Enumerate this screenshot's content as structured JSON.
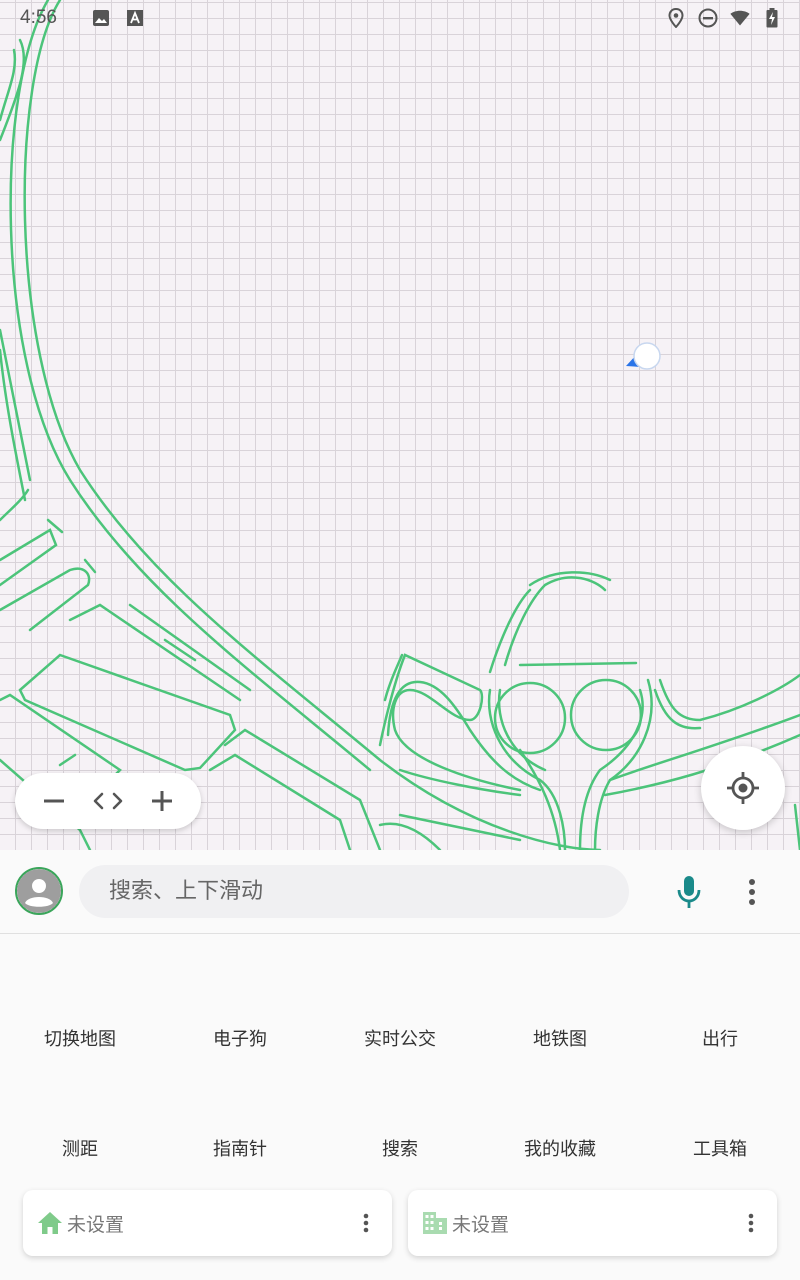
{
  "status_bar": {
    "time": "4:56",
    "left_icons": [
      "image-icon",
      "font-icon"
    ],
    "right_icons": [
      "location-pin-icon",
      "do-not-disturb-icon",
      "wifi-icon",
      "battery-charging-icon"
    ]
  },
  "map": {
    "road_color": "#4cc47a",
    "background_color": "#f6f2f6"
  },
  "zoom_controls": {
    "zoom_out_icon": "minus-icon",
    "code_icon": "code-icon",
    "zoom_in_icon": "plus-icon"
  },
  "search": {
    "placeholder": "搜索、上下滑动",
    "mic_color": "#1a8a8a"
  },
  "quick_actions": {
    "row1": [
      "切换地图",
      "电子狗",
      "实时公交",
      "地铁图",
      "出行"
    ],
    "row2": [
      "测距",
      "指南针",
      "搜索",
      "我的收藏",
      "工具箱"
    ]
  },
  "shortcuts": {
    "home": {
      "label": "未设置",
      "icon": "home-icon"
    },
    "work": {
      "label": "未设置",
      "icon": "building-icon"
    }
  }
}
